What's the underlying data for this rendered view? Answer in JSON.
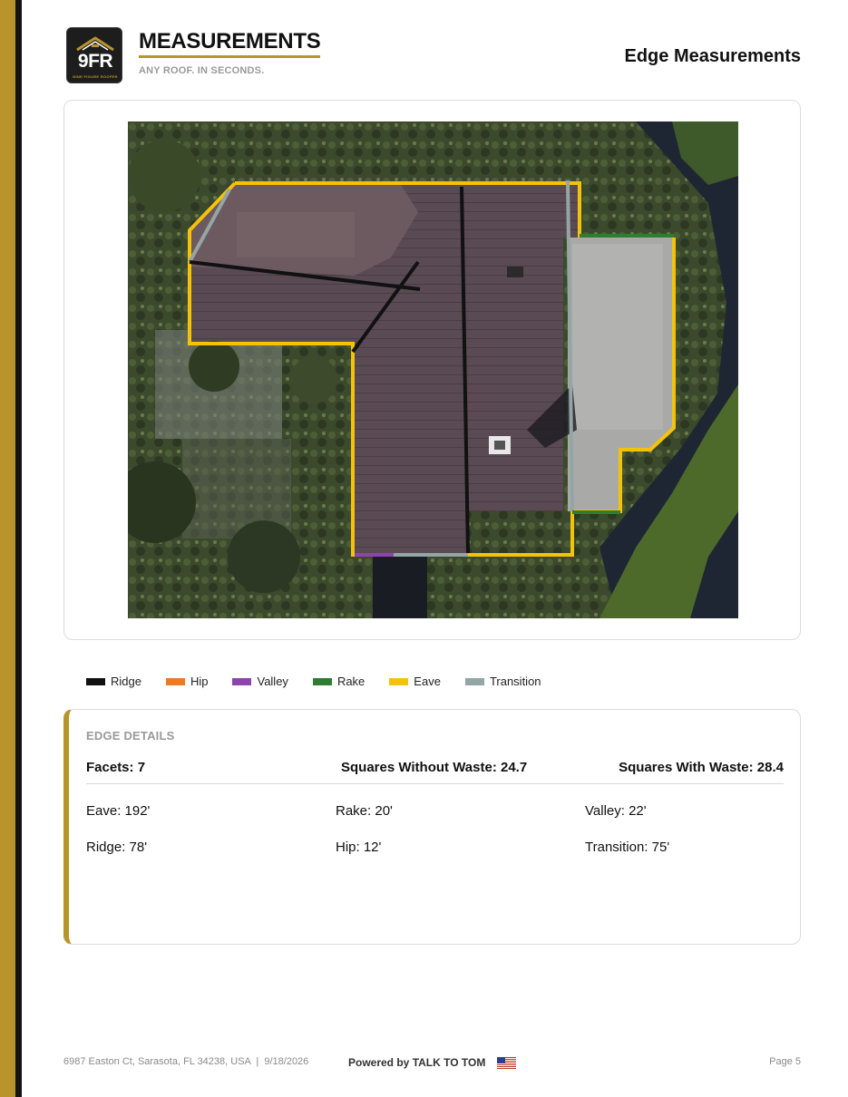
{
  "header": {
    "logo_text": "9FR",
    "logo_subtext": "NINE FIGURE ROOFER",
    "brand_title": "MEASUREMENTS",
    "brand_tagline": "ANY ROOF. IN SECONDS.",
    "page_heading": "Edge Measurements"
  },
  "colors": {
    "accent_gold": "#b8952b",
    "ridge": "#111111",
    "hip": "#f07a20",
    "valley": "#8e44ad",
    "rake": "#2e7d32",
    "eave": "#f5c20b",
    "transition": "#95a5a6"
  },
  "legend": [
    {
      "label": "Ridge",
      "color": "#111111"
    },
    {
      "label": "Hip",
      "color": "#f07a20"
    },
    {
      "label": "Valley",
      "color": "#8e44ad"
    },
    {
      "label": "Rake",
      "color": "#2e7d32"
    },
    {
      "label": "Eave",
      "color": "#f5c20b"
    },
    {
      "label": "Transition",
      "color": "#95a5a6"
    }
  ],
  "details": {
    "title": "EDGE DETAILS",
    "facets": "Facets: 7",
    "squares_without_waste": "Squares Without Waste: 24.7",
    "squares_with_waste": "Squares With Waste: 28.4",
    "eave": "Eave: 192'",
    "rake": "Rake: 20'",
    "valley": "Valley: 22'",
    "ridge": "Ridge: 78'",
    "hip": "Hip: 12'",
    "transition": "Transition: 75'"
  },
  "footer": {
    "address": "6987 Easton Ct, Sarasota, FL 34238, USA  |  9/18/2026",
    "powered_by": "Powered by TALK TO TOM",
    "page": "Page 5"
  }
}
